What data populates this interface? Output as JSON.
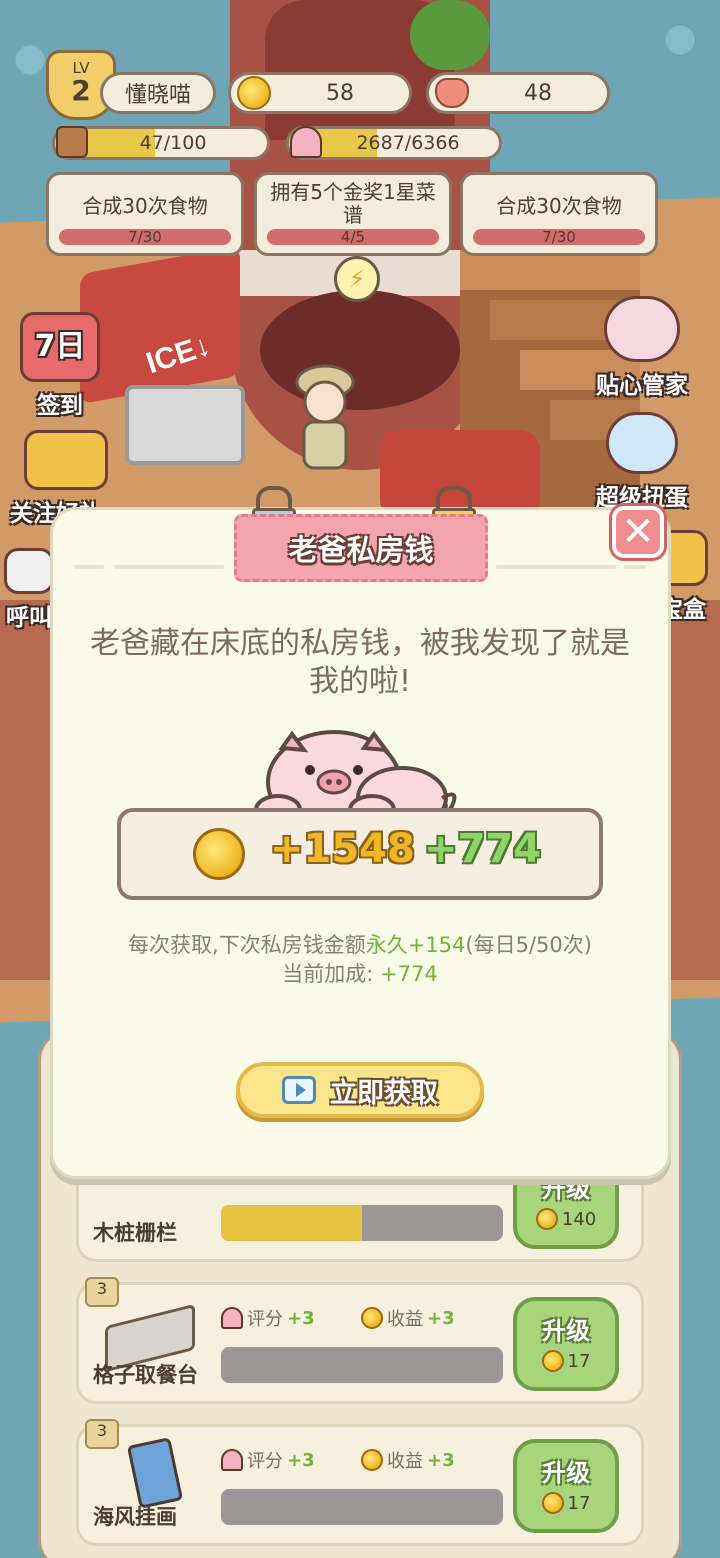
{
  "player": {
    "level_prefix": "LV",
    "level": "2",
    "name": "懂晓喵",
    "coins": "58",
    "gems": "48",
    "exp_text": "47/100",
    "exp_fraction": 0.47,
    "rating_text": "2687/6366",
    "rating_fraction": 0.42
  },
  "tasks": [
    {
      "title": "合成30次食物",
      "progress": "7/30",
      "fraction": 0.23
    },
    {
      "title": "拥有5个金奖1星菜谱",
      "progress": "4/5",
      "fraction": 0.8
    },
    {
      "title": "合成30次食物",
      "progress": "7/30",
      "fraction": 0.23
    }
  ],
  "side_buttons": {
    "checkin": "签到",
    "follow": "关注好礼",
    "summon": "呼叫",
    "butler": "贴心管家",
    "gacha": "超级扭蛋",
    "treasure": "宝盒"
  },
  "scene": {
    "ice_label": "ICE↓",
    "checkin_badge": "7日"
  },
  "upgrades": {
    "score_label": "评分",
    "income_label": "收益",
    "bonus": "+3",
    "button_label": "升级",
    "items": [
      {
        "name": "木桩栅栏",
        "level": "",
        "cost": "140",
        "progress_fraction": 0.5
      },
      {
        "name": "格子取餐台",
        "level": "3",
        "cost": "17",
        "progress_fraction": 0.0
      },
      {
        "name": "海风挂画",
        "level": "3",
        "cost": "17",
        "progress_fraction": 0.0
      }
    ]
  },
  "dialog": {
    "title": "老爸私房钱",
    "description": "老爸藏在床底的私房钱，被我发现了就是我的啦!",
    "reward_main": "+1548",
    "reward_bonus": "+774",
    "info_prefix": "每次获取,下次私房钱金额",
    "info_highlight": "永久+154",
    "info_suffix": "(每日5/50次)",
    "bonus_label": "当前加成: ",
    "bonus_value": "+774",
    "claim_label": "立即获取",
    "close_symbol": "✕"
  },
  "colors": {
    "accent_yellow": "#f0b824",
    "accent_green": "#8fd56a",
    "title_pink": "#f4a4ac"
  }
}
